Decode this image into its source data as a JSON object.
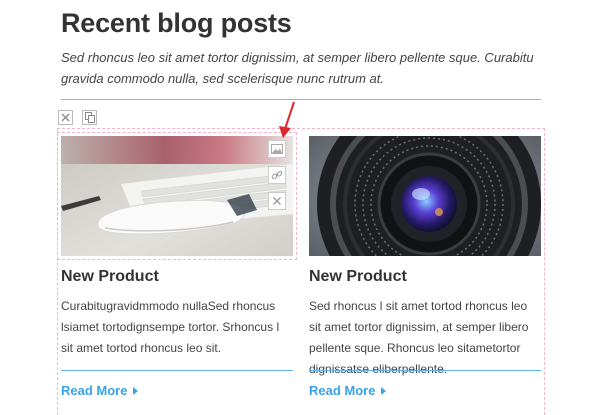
{
  "section": {
    "title": "Recent blog posts",
    "subtitle": "Sed rhoncus leo sit amet tortor dignissim, at semper libero pellente sque. Curabitu gravida commodo nulla, sed scelerisque nunc rutrum at."
  },
  "widget_controls": {
    "remove_icon": "close-icon",
    "copy_icon": "copy-icon"
  },
  "image_controls": {
    "icons": [
      "image-icon",
      "link-icon",
      "close-icon"
    ]
  },
  "posts": [
    {
      "title": "New Product",
      "excerpt": "Curabitugravidmmodo nullaSed rhoncus lsiamet tortodignsempe tortor. Srhoncus l sit amet tortod rhoncus leo sit.",
      "read_more": "Read More",
      "image": "keyboard-and-mouse-photo"
    },
    {
      "title": "New Product",
      "excerpt": "Sed rhoncus l sit amet tortod rhoncus leo sit amet tortor dignissim, at semper libero pellente sque. Rhoncus leo sitametortor dignissatse eliberpellente.",
      "read_more": "Read More",
      "image": "camera-lens-photo"
    }
  ],
  "colors": {
    "accent": "#3aa3e8",
    "divider_green": "#7ed957",
    "selection_pink": "#f2b6cc",
    "arrow_red": "#e0252b"
  }
}
